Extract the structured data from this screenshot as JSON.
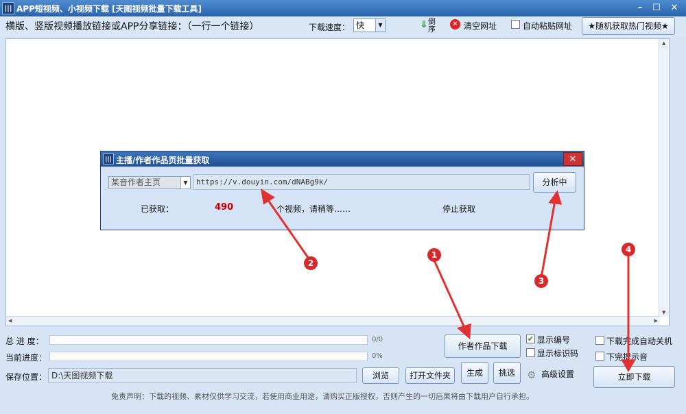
{
  "window": {
    "title": "APP短视频、小视频下载 [天图视频批量下载工具]",
    "app_icon": "bars-logo-icon",
    "controls": [
      "minimize",
      "maximize",
      "close"
    ]
  },
  "toolbar": {
    "instruction": "横版、竖版视频播放链接或APP分享链接：（一行一个链接）",
    "speed_label": "下载速度：",
    "speed_value": "快",
    "reverse_label": "倒序",
    "clear_label": "清空网址",
    "auto_paste_label": "自动粘贴网址",
    "auto_paste_checked": false,
    "hot_videos_button": "★随机获取热门视频★"
  },
  "dialog": {
    "title": "主播/作者作品页批量获取",
    "source_select": "某音作者主页",
    "url_value": "https://v.douyin.com/dNABg9k/",
    "analyze_button": "分析中",
    "fetched_label": "已获取：",
    "fetched_count": "490",
    "status_text": "个视频，请稍等……",
    "stop_label": "停止获取"
  },
  "bottom": {
    "total_progress_label": "总 进 度：",
    "total_progress_text": "0/0",
    "current_progress_label": "当前进度：",
    "current_progress_text": "0%",
    "save_location_label": "保存位置：",
    "save_path": "D:\\天图视频下载",
    "browse_button": "浏览",
    "open_folder_button": "打开文件夹",
    "author_download_button": "作者作品下载",
    "generate_button": "生成",
    "pick_button": "挑选",
    "show_number_label": "显示编号",
    "show_number_checked": true,
    "show_watermark_label": "显示标识码",
    "show_watermark_checked": false,
    "advanced_settings_label": "高级设置",
    "shutdown_label": "下载完成自动关机",
    "shutdown_checked": false,
    "sound_label": "下完提示音",
    "sound_checked": false,
    "download_now_button": "立即下载",
    "disclaimer": "免责声明：下载的视频、素材仅供学习交流，若使用商业用途，请购买正版授权，否则产生的一切后果将由下载用户自行承担。"
  },
  "annotations": {
    "markers": [
      "1",
      "2",
      "3",
      "4"
    ],
    "marker_color": "#d62a2a"
  }
}
